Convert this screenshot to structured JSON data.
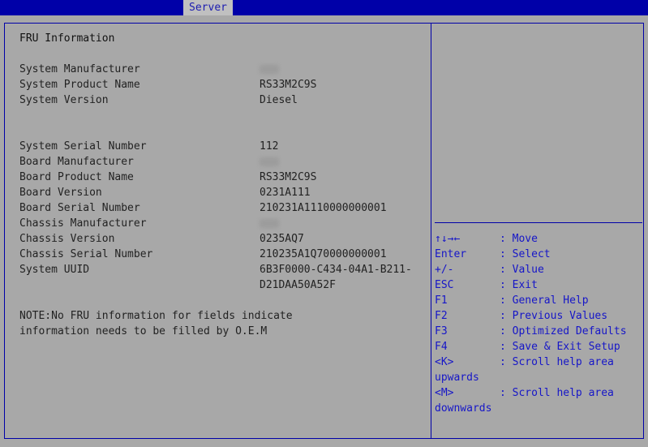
{
  "tab_label": "Server",
  "section_title": "FRU Information",
  "fields": [
    {
      "label": "System Manufacturer",
      "value": "",
      "masked": true
    },
    {
      "label": "System Product Name",
      "value": "RS33M2C9S"
    },
    {
      "label": "System Version",
      "value": "Diesel"
    },
    {
      "label": "System Serial Number",
      "value": "112"
    },
    {
      "label": "Board Manufacturer",
      "value": "",
      "masked": true
    },
    {
      "label": "Board Product Name",
      "value": "RS33M2C9S"
    },
    {
      "label": "Board Version",
      "value": "0231A111"
    },
    {
      "label": "Board Serial Number",
      "value": "210231A1110000000001"
    },
    {
      "label": "Chassis Manufacturer",
      "value": "",
      "masked": true
    },
    {
      "label": "Chassis Version",
      "value": "0235AQ7"
    },
    {
      "label": "Chassis Serial Number",
      "value": "210235A1Q70000000001"
    },
    {
      "label": "System UUID",
      "value": "6B3F0000-C434-04A1-B211-",
      "value_cont": "D21DAA50A52F"
    }
  ],
  "note_lines": [
    "NOTE:No FRU information for fields indicate",
    "information needs to be filled by O.E.M"
  ],
  "help": [
    {
      "key": "↑↓→←",
      "desc": ": Move"
    },
    {
      "key": "Enter",
      "desc": ": Select"
    },
    {
      "key": "+/-",
      "desc": ": Value"
    },
    {
      "key": "ESC",
      "desc": ": Exit"
    },
    {
      "key": "F1",
      "desc": ": General Help"
    },
    {
      "key": "F2",
      "desc": ": Previous Values"
    },
    {
      "key": "F3",
      "desc": ": Optimized Defaults"
    },
    {
      "key": "F4",
      "desc": ": Save & Exit Setup"
    },
    {
      "key": "<K>",
      "desc": ": Scroll help area",
      "cont": "upwards"
    },
    {
      "key": "<M>",
      "desc": ": Scroll help area",
      "cont": "downwards"
    }
  ],
  "colors": {
    "screen_bg": "#a8a8a8",
    "frame_blue": "#0000a8",
    "help_text": "#1616c8",
    "body_text": "#222222"
  }
}
